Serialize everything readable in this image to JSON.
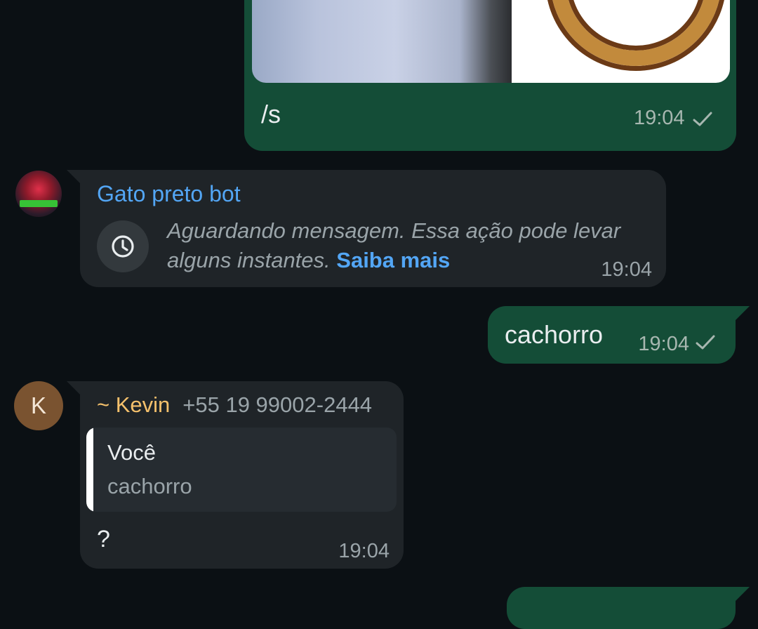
{
  "chat": {
    "messages": [
      {
        "type": "outgoing-image",
        "caption": "/s",
        "time": "19:04",
        "status": "sent"
      },
      {
        "type": "incoming",
        "sender": "Gato preto bot",
        "text": "Aguardando mensagem. Essa ação pode levar alguns instantes.",
        "link": "Saiba mais",
        "time": "19:04"
      },
      {
        "type": "outgoing",
        "text": "cachorro",
        "time": "19:04",
        "status": "sent"
      },
      {
        "type": "incoming",
        "sender": "~ Kevin",
        "phone": "+55 19 99002-2444",
        "avatar_letter": "K",
        "quote": {
          "author": "Você",
          "text": "cachorro"
        },
        "text": "?",
        "time": "19:04"
      }
    ]
  },
  "colors": {
    "background": "#0b1014",
    "outgoing_bubble": "#144d37",
    "incoming_bubble": "#1f2428",
    "link_blue": "#53a6f5",
    "sender_kevin": "#f5c16c"
  },
  "icons": [
    "check-icon",
    "clock-icon"
  ]
}
